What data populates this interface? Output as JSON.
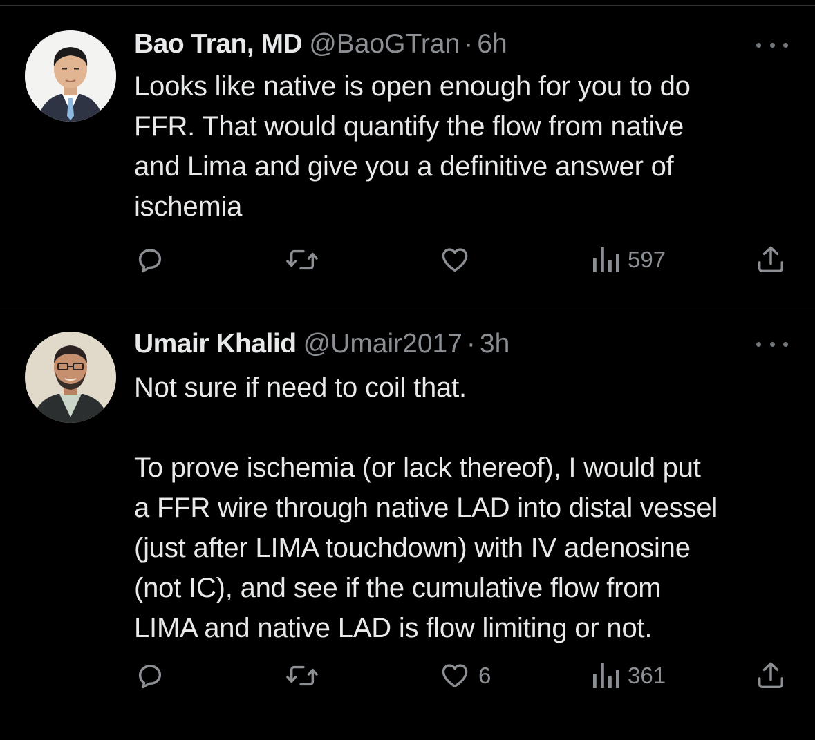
{
  "tweets": [
    {
      "author_name": "Bao Tran, MD",
      "handle": "@BaoGTran",
      "separator": "·",
      "time": "6h",
      "text": "Looks like native is open enough for you to do\nFFR. That would quantify the flow from native\nand Lima and give you a definitive answer of\nischemia",
      "likes": "",
      "views": "597"
    },
    {
      "author_name": "Umair Khalid",
      "handle": "@Umair2017",
      "separator": "·",
      "time": "3h",
      "text": "Not sure if need to coil that.\n\nTo prove ischemia (or lack thereof), I would put\na FFR wire through native LAD into distal vessel\n(just after LIMA touchdown) with IV adenosine\n(not IC), and see if the cumulative flow from\nLIMA and native LAD is flow limiting or not.",
      "likes": "6",
      "views": "361"
    }
  ],
  "icons": {
    "reply": "reply-icon",
    "retweet": "retweet-icon",
    "like": "heart-icon",
    "views": "views-icon",
    "share": "share-icon",
    "more": "more-icon"
  },
  "colors": {
    "background": "#000000",
    "text": "#e7e9ea",
    "muted": "#8b8f93",
    "divider": "#2f3336"
  }
}
